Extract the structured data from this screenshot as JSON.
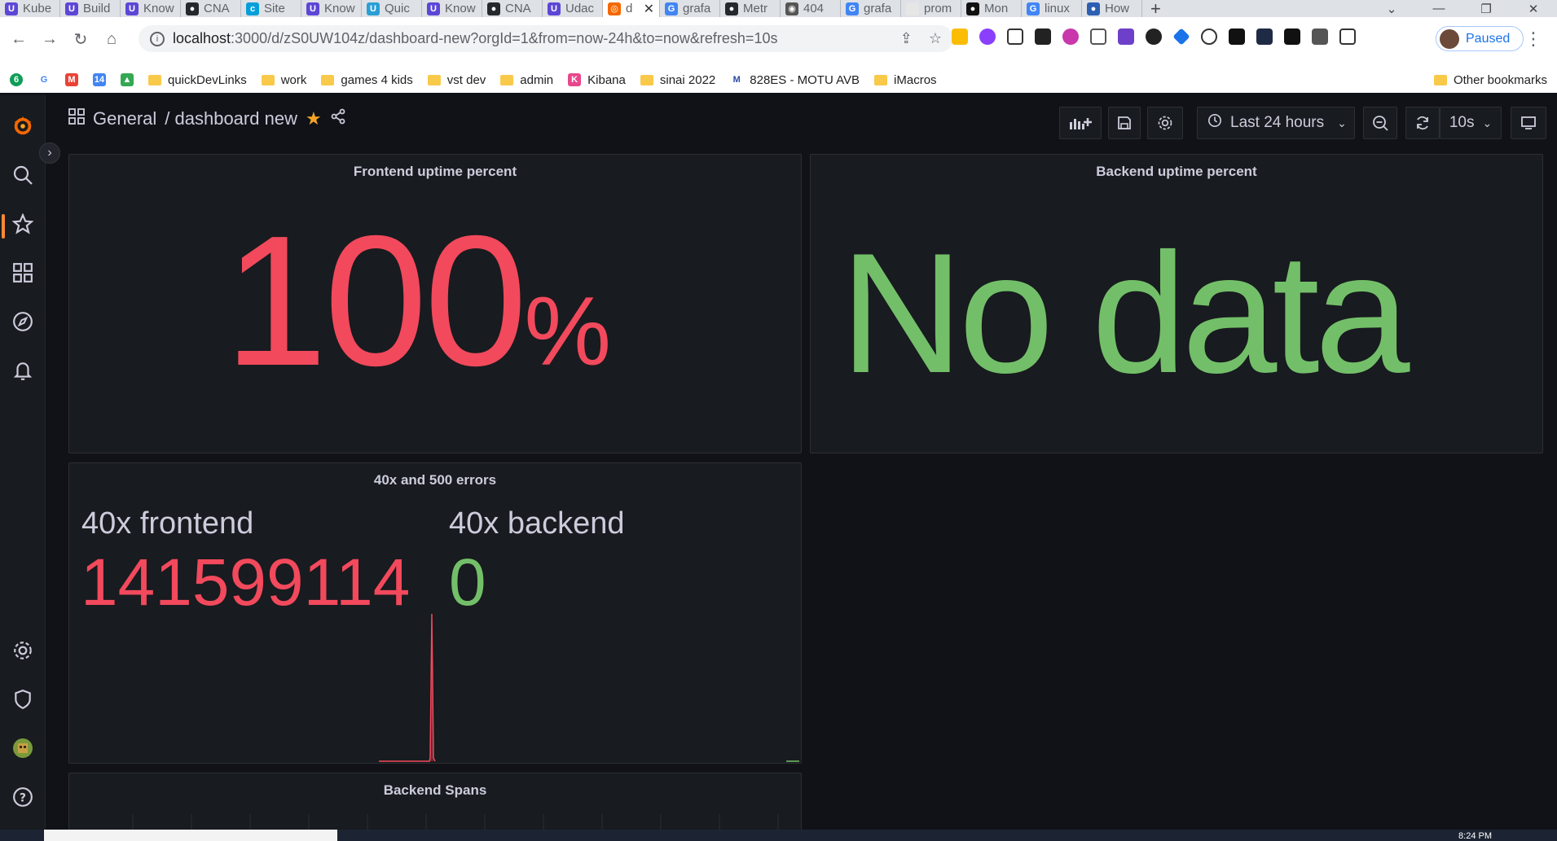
{
  "browser": {
    "tabs": [
      {
        "label": "Kube",
        "color": "#5b47d6",
        "glyph": "U"
      },
      {
        "label": "Build",
        "color": "#5b47d6",
        "glyph": "U"
      },
      {
        "label": "Know",
        "color": "#5b47d6",
        "glyph": "U"
      },
      {
        "label": "CNA",
        "color": "#24292f",
        "glyph": "●"
      },
      {
        "label": "Site",
        "color": "#049fd9",
        "glyph": "c"
      },
      {
        "label": "Know",
        "color": "#5b47d6",
        "glyph": "U"
      },
      {
        "label": "Quic",
        "color": "#2a9fd6",
        "glyph": "U"
      },
      {
        "label": "Know",
        "color": "#5b47d6",
        "glyph": "U"
      },
      {
        "label": "CNA",
        "color": "#24292f",
        "glyph": "●"
      },
      {
        "label": "Udac",
        "color": "#5b47d6",
        "glyph": "U"
      },
      {
        "label": "d",
        "color": "#f46800",
        "glyph": "◎",
        "active": true
      },
      {
        "label": "grafa",
        "color": "#4285f4",
        "glyph": "G"
      },
      {
        "label": "Metr",
        "color": "#24292f",
        "glyph": "●"
      },
      {
        "label": "404",
        "color": "#555",
        "glyph": "◉"
      },
      {
        "label": "grafa",
        "color": "#4285f4",
        "glyph": "G"
      },
      {
        "label": "prom",
        "color": "#e6e6e6",
        "glyph": ""
      },
      {
        "label": "Mon",
        "color": "#111",
        "glyph": "●"
      },
      {
        "label": "linux",
        "color": "#4285f4",
        "glyph": "G"
      },
      {
        "label": "How",
        "color": "#2c5fb3",
        "glyph": "●"
      }
    ],
    "url_host": "localhost",
    "url_path": ":3000/d/zS0UW104z/dashboard-new?orgId=1&from=now-24h&to=now&refresh=10s",
    "profile_label": "Paused",
    "bookmarks": [
      {
        "label": "quickDevLinks"
      },
      {
        "label": "work"
      },
      {
        "label": "games 4 kids"
      },
      {
        "label": "vst dev"
      },
      {
        "label": "admin"
      },
      {
        "label": "Kibana",
        "icon": "kibana"
      },
      {
        "label": "sinai 2022"
      },
      {
        "label": "828ES - MOTU AVB",
        "icon": "motu"
      },
      {
        "label": "iMacros"
      }
    ],
    "other_bookmarks": "Other bookmarks"
  },
  "dashboard": {
    "folder": "General",
    "title": "/ dashboard new",
    "time_range": "Last 24 hours",
    "refresh": "10s"
  },
  "panels": {
    "frontend_uptime": {
      "title": "Frontend uptime percent",
      "value": "100",
      "unit": "%",
      "color": "#f2495c"
    },
    "backend_uptime": {
      "title": "Backend uptime percent",
      "value": "No data",
      "color": "#73bf69"
    },
    "errors": {
      "title": "40x and 500 errors",
      "stats": [
        {
          "label": "40x frontend",
          "value": "141599114",
          "color": "#f2495c"
        },
        {
          "label": "40x backend",
          "value": "0",
          "color": "#73bf69"
        }
      ]
    },
    "backend_spans": {
      "title": "Backend Spans"
    }
  },
  "taskbar": {
    "time": "8:24 PM"
  }
}
